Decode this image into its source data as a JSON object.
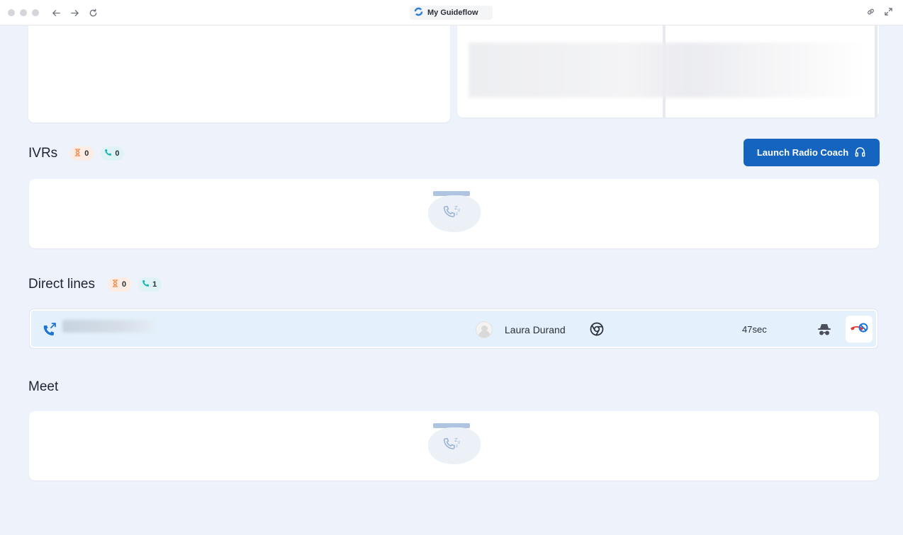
{
  "browser": {
    "title": "My Guideflow",
    "icons": [
      "back-arrow-icon",
      "forward-arrow-icon",
      "reload-icon",
      "link-icon",
      "expand-icon"
    ]
  },
  "sections": {
    "ivrs": {
      "title": "IVRs",
      "waiting_count": "0",
      "active_count": "0"
    },
    "direct_lines": {
      "title": "Direct lines",
      "waiting_count": "0",
      "active_count": "1",
      "calls": [
        {
          "agent_name": "Laura Durand",
          "duration": "47sec",
          "direction_icon": "outgoing-call-icon",
          "browser_icon": "chrome-icon"
        }
      ]
    },
    "meet": {
      "title": "Meet"
    }
  },
  "actions": {
    "launch_radio_coach_label": "Launch Radio Coach"
  },
  "colors": {
    "primary": "#1565c0",
    "waiting_badge": "#fdece3",
    "call_badge": "#e0f3f4",
    "row_highlight": "#e4f0fb",
    "hangup_red": "#e53935"
  }
}
